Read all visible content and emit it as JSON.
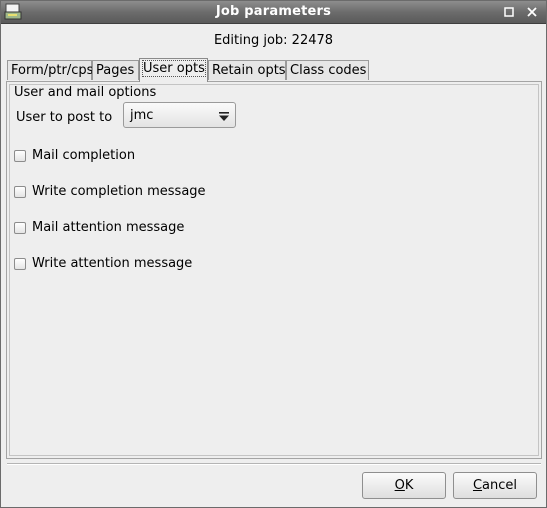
{
  "window": {
    "title": "Job parameters",
    "maximize_icon": "maximize-icon",
    "close_icon": "close-icon"
  },
  "header": {
    "editing_text": "Editing job: 22478"
  },
  "tabs": [
    {
      "label": "Form/ptr/cps",
      "active": false
    },
    {
      "label": "Pages",
      "active": false
    },
    {
      "label": "User opts",
      "active": true
    },
    {
      "label": "Retain opts",
      "active": false
    },
    {
      "label": "Class codes",
      "active": false
    }
  ],
  "user_opts": {
    "group_title": "User and mail options",
    "user_label": "User to post to",
    "user_value": "jmc",
    "checkboxes": [
      {
        "label": "Mail completion",
        "checked": false
      },
      {
        "label": "Write completion message",
        "checked": false
      },
      {
        "label": "Mail attention message",
        "checked": false
      },
      {
        "label": "Write attention message",
        "checked": false
      }
    ]
  },
  "buttons": {
    "ok_mnemonic": "O",
    "ok_rest": "K",
    "cancel_mnemonic": "C",
    "cancel_rest": "ancel"
  }
}
